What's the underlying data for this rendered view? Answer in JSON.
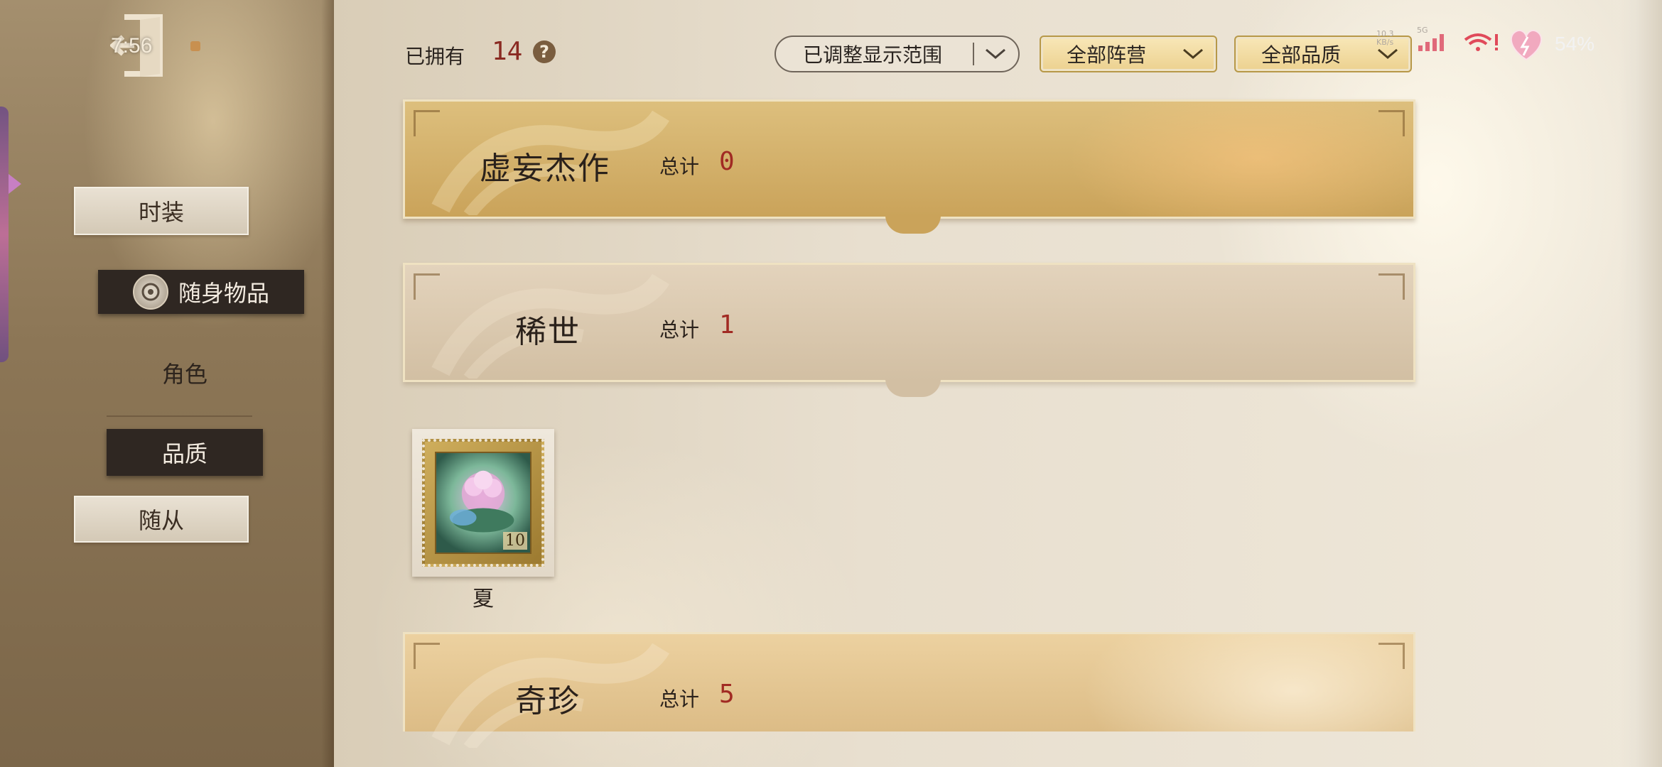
{
  "status_bar": {
    "time": "7:56",
    "network_speed_top": "10.3",
    "network_speed_bottom": "KB/s",
    "network_type": "5G",
    "battery": "54%"
  },
  "sidebar": {
    "tabs": [
      {
        "label": "时装",
        "state": "unselected"
      },
      {
        "label": "随身物品",
        "state": "selected"
      },
      {
        "label": "角色",
        "state": "plain"
      },
      {
        "label": "品质",
        "state": "selected"
      },
      {
        "label": "随从",
        "state": "unselected"
      }
    ]
  },
  "header": {
    "owned_label": "已拥有",
    "owned_count": "14",
    "help_glyph": "?",
    "filters": {
      "range": "已调整显示范围",
      "faction": "全部阵营",
      "quality": "全部品质"
    }
  },
  "sections": [
    {
      "title": "虚妄杰作",
      "total_label": "总计",
      "total": "0"
    },
    {
      "title": "稀世",
      "total_label": "总计",
      "total": "1",
      "items": [
        {
          "name": "夏",
          "stamp_value": "10"
        }
      ]
    },
    {
      "title": "奇珍",
      "total_label": "总计",
      "total": "5"
    }
  ],
  "colors": {
    "accent_red": "#a12a23",
    "dark_tab": "#2f2722",
    "gold_banner": "#caa35a",
    "paper": "#efe8da"
  },
  "icons": [
    "exit-door-icon",
    "expand-arrow-icon",
    "emblem-icon",
    "help-icon",
    "chevron-down-icon",
    "signal-icon",
    "wifi-icon",
    "heart-icon"
  ]
}
